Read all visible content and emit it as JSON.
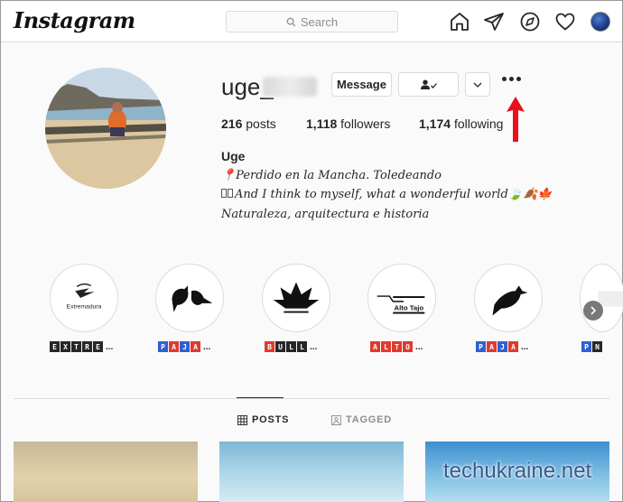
{
  "nav": {
    "logo": "Instagram",
    "search_placeholder": "Search"
  },
  "profile": {
    "username": "uge_",
    "buttons": {
      "message": "Message"
    },
    "stats": {
      "posts_count": "216",
      "posts_label": "posts",
      "followers_count": "1,118",
      "followers_label": "followers",
      "following_count": "1,174",
      "following_label": "following"
    },
    "bio": {
      "name": "Uge",
      "line1": "📍Perdido en la Mancha. Toledeando",
      "line2": "And I think to myself, what a wonderful world🍃🍂🍁",
      "line3": "Naturaleza, arquitectura e historia"
    }
  },
  "highlights": [
    {
      "name": "Extremadura",
      "label_chars": [
        "E",
        "X",
        "T",
        "R",
        "E"
      ],
      "chip_colors": [
        "k",
        "k",
        "k",
        "k",
        "k"
      ]
    },
    {
      "name": "Pájaros",
      "label_chars": [
        "P",
        "A",
        "J",
        "A"
      ],
      "chip_colors": [
        "b",
        "r",
        "b",
        "r"
      ]
    },
    {
      "name": "Bull",
      "label_chars": [
        "B",
        "U",
        "L",
        "L"
      ],
      "chip_colors": [
        "r",
        "k",
        "k",
        "k"
      ]
    },
    {
      "name": "Alto",
      "label_chars": [
        "A",
        "L",
        "T",
        "O"
      ],
      "chip_colors": [
        "r",
        "r",
        "r",
        "r"
      ]
    },
    {
      "name": "Pája",
      "label_chars": [
        "P",
        "A",
        "J",
        "A"
      ],
      "chip_colors": [
        "b",
        "r",
        "b",
        "r"
      ]
    },
    {
      "name": "N",
      "label_chars": [
        "P",
        "N"
      ],
      "chip_colors": [
        "b",
        "k"
      ]
    }
  ],
  "highlight_texts": {
    "extremadura": "Extremadura",
    "alto_tajo": "Alto Tajo"
  },
  "tabs": {
    "posts": "POSTS",
    "tagged": "TAGGED"
  },
  "watermark": "techukraine.net",
  "colors": {
    "accent_red": "#e8101c",
    "border": "#dbdbdb",
    "bg": "#fafafa"
  },
  "icons": [
    "home-icon",
    "direct-icon",
    "explore-icon",
    "heart-icon",
    "search-icon",
    "grid-icon",
    "tag-icon",
    "follow-check-icon",
    "chevron-down-icon",
    "more-icon"
  ]
}
